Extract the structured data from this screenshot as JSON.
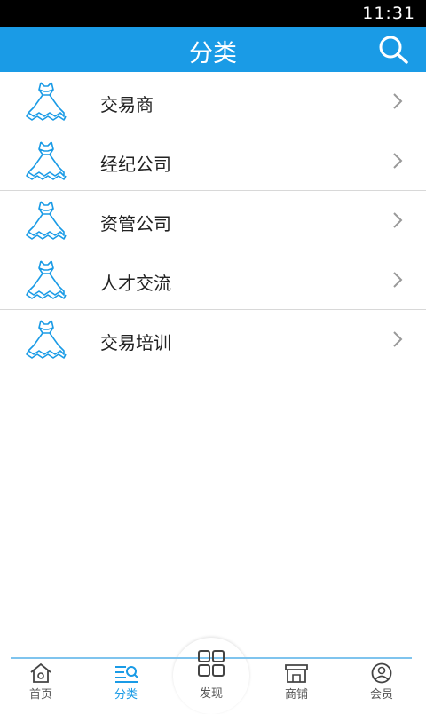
{
  "status_bar": {
    "time": "11:31"
  },
  "header": {
    "title": "分类"
  },
  "categories": [
    {
      "label": "交易商"
    },
    {
      "label": "经纪公司"
    },
    {
      "label": "资管公司"
    },
    {
      "label": "人才交流"
    },
    {
      "label": "交易培训"
    }
  ],
  "bottom_nav": [
    {
      "label": "首页",
      "icon": "home-icon"
    },
    {
      "label": "分类",
      "icon": "category-icon",
      "active": true
    },
    {
      "label": "发现",
      "icon": "grid-icon"
    },
    {
      "label": "商铺",
      "icon": "shop-icon"
    },
    {
      "label": "会员",
      "icon": "user-icon"
    }
  ],
  "colors": {
    "accent": "#1a9be6",
    "status_bar": "#000000",
    "divider": "#d8d8d8"
  }
}
